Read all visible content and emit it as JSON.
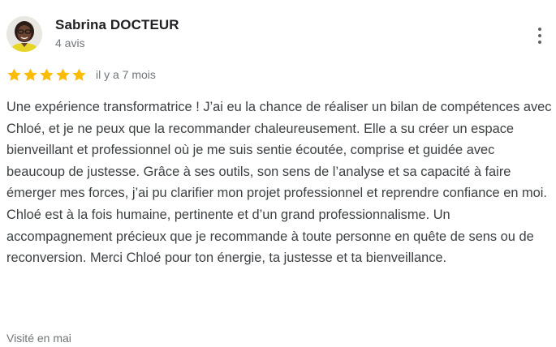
{
  "review": {
    "author": {
      "name": "Sabrina DOCTEUR",
      "review_count": "4 avis",
      "avatar_icon": "user-avatar-photo"
    },
    "menu_icon": "more-vertical-icon",
    "rating": {
      "stars": 5,
      "max": 5,
      "star_color": "#fbbc04"
    },
    "relative_date": "il y a 7 mois",
    "text": "Une expérience transformatrice ! J’ai eu la chance de réaliser un bilan de compétences avec Chloé, et je ne peux que la recommander chaleureusement. Elle a su créer un espace bienveillant et professionnel où je me suis sentie écoutée, comprise et guidée avec beaucoup de justesse. Grâce à ses outils, son sens de l’analyse et sa capacité à faire émerger mes forces, j’ai pu clarifier mon projet professionnel et reprendre confiance en moi. Chloé est à la fois humaine, pertinente et d’un grand professionnalisme. Un accompagnement précieux que je recommande à toute personne en quête de sens ou de reconversion. Merci Chloé pour ton énergie, ta justesse et ta bienveillance.",
    "visited": "Visité en mai"
  }
}
